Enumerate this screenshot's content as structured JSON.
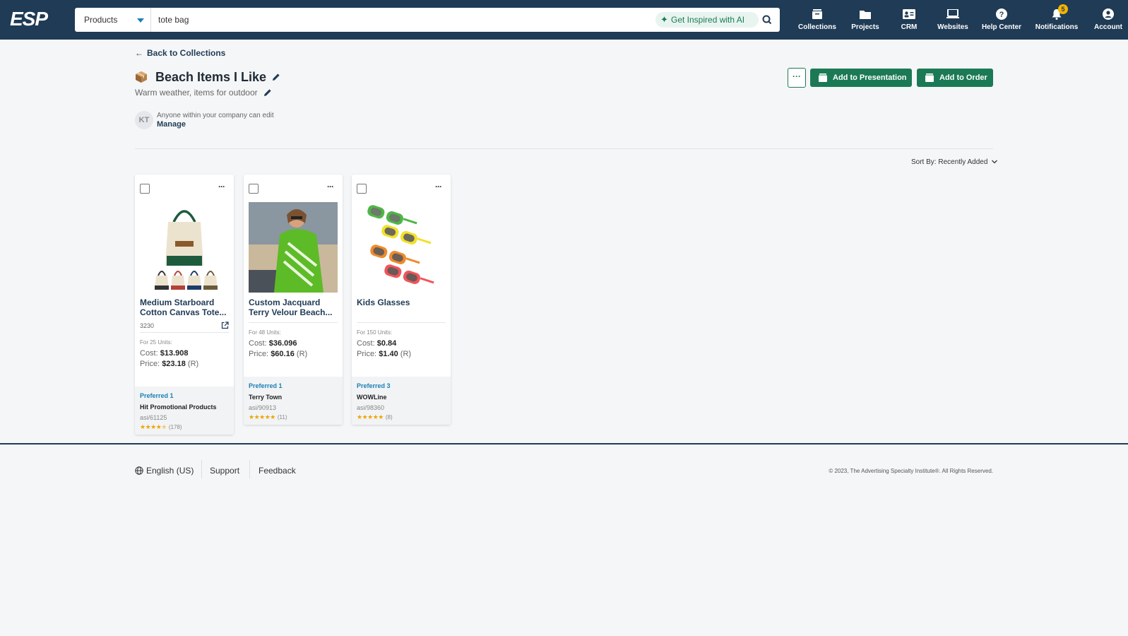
{
  "nav": {
    "logo": "ESP",
    "search_scope": "Products",
    "search_value": "tote bag",
    "ai_button": "Get Inspired with AI",
    "items": [
      {
        "label": "Collections",
        "icon": "collections-icon"
      },
      {
        "label": "Projects",
        "icon": "folder-icon"
      },
      {
        "label": "CRM",
        "icon": "contact-card-icon"
      },
      {
        "label": "Websites",
        "icon": "laptop-icon"
      },
      {
        "label": "Help Center",
        "icon": "help-icon"
      },
      {
        "label": "Notifications",
        "icon": "bell-icon",
        "badge": "5"
      },
      {
        "label": "Account",
        "icon": "account-icon"
      }
    ]
  },
  "page": {
    "back_link": "Back to Collections",
    "title": "Beach Items I Like",
    "subtitle": "Warm weather, items for outdoor",
    "owner_initials": "KT",
    "permission_text": "Anyone within your company can edit",
    "manage_link": "Manage",
    "more_label": "···",
    "add_to_presentation": "Add to Presentation",
    "add_to_order": "Add to Order",
    "sort_label": "Sort By: Recently Added"
  },
  "products": [
    {
      "name_line1": "Medium Starboard",
      "name_line2": "Cotton Canvas Tote...",
      "sku": "3230",
      "units": "For 25 Units:",
      "cost_label": "Cost:",
      "cost": "$13.908",
      "price_label": "Price:",
      "price": "$23.18",
      "price_suffix": "(R)",
      "preferred": "Preferred 1",
      "supplier": "Hit Promotional Products",
      "asi": "asi/61125",
      "rating": 4.5,
      "reviews": "(178)"
    },
    {
      "name_line1": "Custom Jacquard",
      "name_line2": "Terry Velour Beach...",
      "units": "For 48 Units:",
      "cost_label": "Cost:",
      "cost": "$36.096",
      "price_label": "Price:",
      "price": "$60.16",
      "price_suffix": "(R)",
      "preferred": "Preferred 1",
      "supplier": "Terry Town",
      "asi": "asi/90913",
      "rating": 5,
      "reviews": "(11)"
    },
    {
      "name_line1": "Kids Glasses",
      "name_line2": "",
      "units": "For 150 Units:",
      "cost_label": "Cost:",
      "cost": "$0.84",
      "price_label": "Price:",
      "price": "$1.40",
      "price_suffix": "(R)",
      "preferred": "Preferred 3",
      "supplier": "WOWLine",
      "asi": "asi/98360",
      "rating": 5,
      "reviews": "(8)"
    }
  ],
  "footer": {
    "language": "English (US)",
    "support": "Support",
    "feedback": "Feedback",
    "copyright": "© 2023, The Advertising Specialty Institute®. All Rights Reserved."
  },
  "colors": {
    "nav_bg": "#1f3b55",
    "accent_green": "#1b7a55",
    "link_blue": "#1a7fb3",
    "star": "#f0a500"
  }
}
